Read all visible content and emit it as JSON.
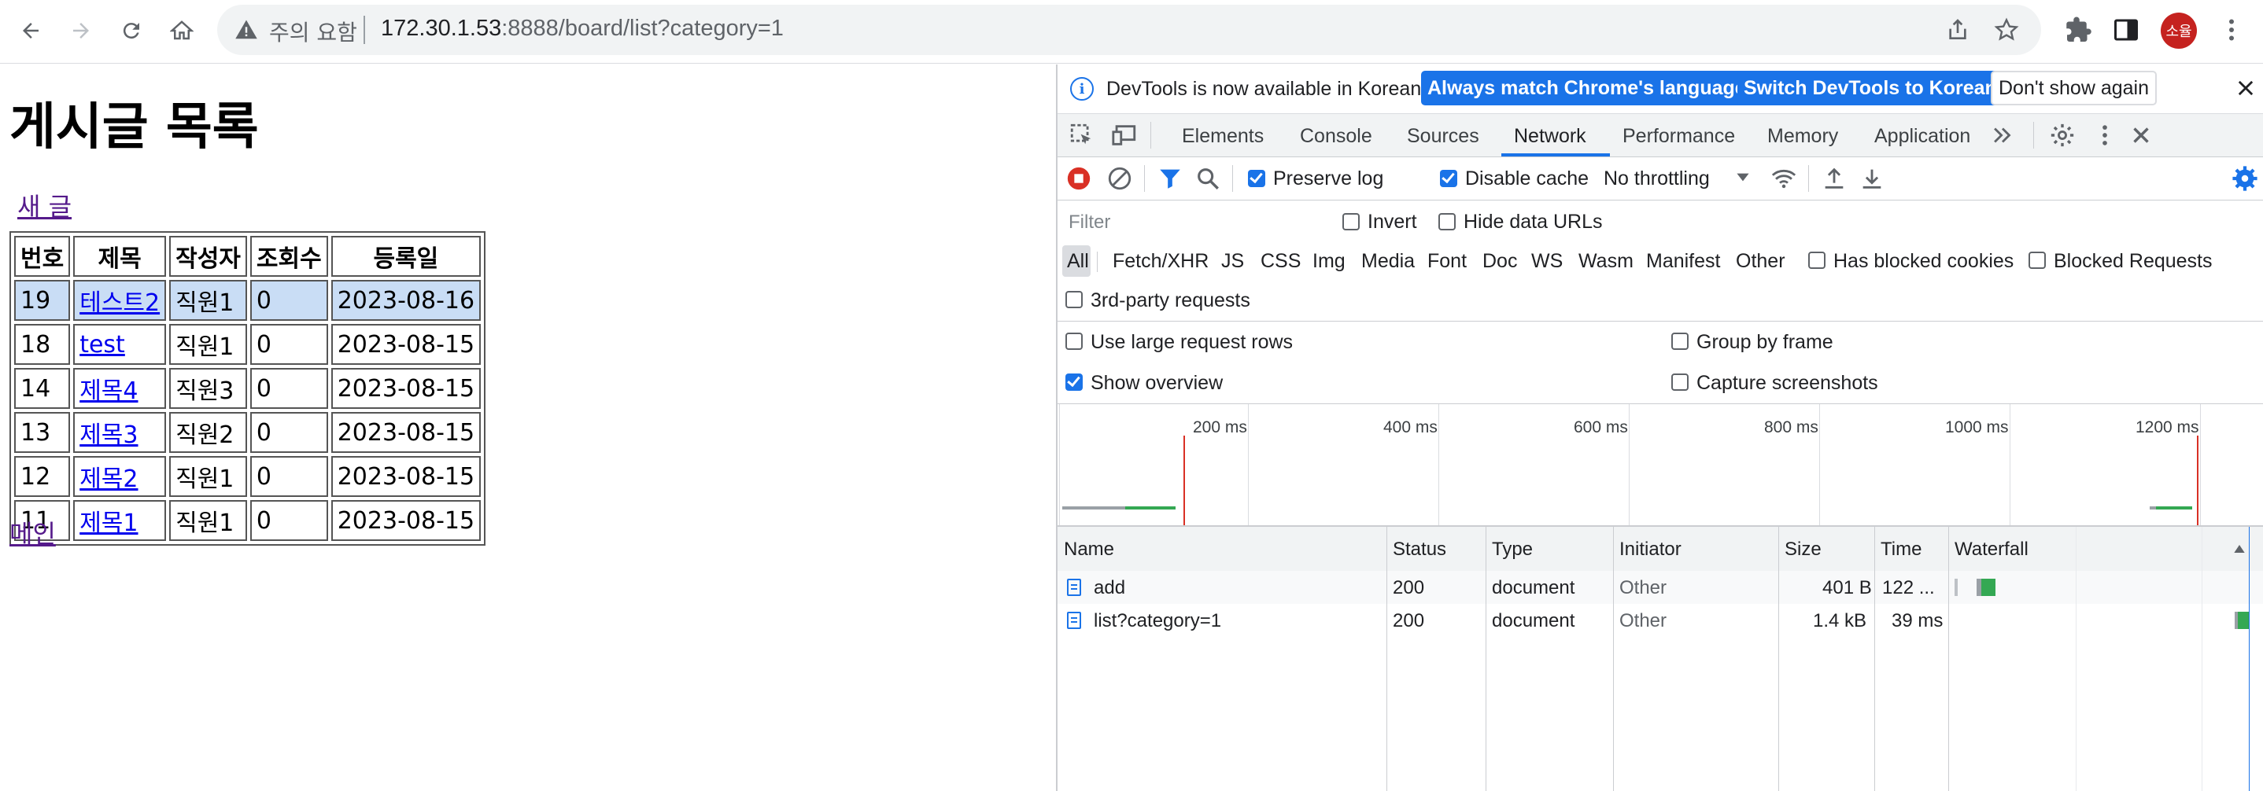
{
  "browser": {
    "warning_label": "주의 요함",
    "url_host": "172.30.1.53",
    "url_rest": ":8888/board/list?category=1",
    "avatar_label": "소율"
  },
  "page": {
    "title": "게시글 목록",
    "new_post_link": "새 글",
    "main_link": "메인",
    "table": {
      "headers": [
        "번호",
        "제목",
        "작성자",
        "조회수",
        "등록일"
      ],
      "rows": [
        {
          "no": "19",
          "title": "테스트2",
          "author": "직원1",
          "views": "0",
          "date": "2023-08-16"
        },
        {
          "no": "18",
          "title": "test",
          "author": "직원1",
          "views": "0",
          "date": "2023-08-15"
        },
        {
          "no": "14",
          "title": "제목4",
          "author": "직원3",
          "views": "0",
          "date": "2023-08-15"
        },
        {
          "no": "13",
          "title": "제목3",
          "author": "직원2",
          "views": "0",
          "date": "2023-08-15"
        },
        {
          "no": "12",
          "title": "제목2",
          "author": "직원1",
          "views": "0",
          "date": "2023-08-15"
        },
        {
          "no": "11",
          "title": "제목1",
          "author": "직원1",
          "views": "0",
          "date": "2023-08-15"
        }
      ]
    }
  },
  "devtools": {
    "infobar": {
      "message": "DevTools is now available in Korean!",
      "btn_match": "Always match Chrome's language",
      "btn_switch": "Switch DevTools to Korean",
      "btn_dismiss": "Don't show again"
    },
    "tabs": [
      "Elements",
      "Console",
      "Sources",
      "Network",
      "Performance",
      "Memory",
      "Application"
    ],
    "active_tab": "Network",
    "toolbar": {
      "preserve_log": "Preserve log",
      "disable_cache": "Disable cache",
      "throttling": "No throttling"
    },
    "filter": {
      "placeholder": "Filter",
      "invert": "Invert",
      "hide_data_urls": "Hide data URLs"
    },
    "types": [
      "All",
      "Fetch/XHR",
      "JS",
      "CSS",
      "Img",
      "Media",
      "Font",
      "Doc",
      "WS",
      "Wasm",
      "Manifest",
      "Other"
    ],
    "has_blocked_cookies": "Has blocked cookies",
    "blocked_requests": "Blocked Requests",
    "third_party": "3rd-party requests",
    "settings": {
      "large_rows": "Use large request rows",
      "group_by_frame": "Group by frame",
      "show_overview": "Show overview",
      "capture_screenshots": "Capture screenshots"
    },
    "overview_ticks": [
      "200 ms",
      "400 ms",
      "600 ms",
      "800 ms",
      "1000 ms",
      "1200 ms"
    ],
    "columns": [
      "Name",
      "Status",
      "Type",
      "Initiator",
      "Size",
      "Time",
      "Waterfall"
    ],
    "requests": [
      {
        "name": "add",
        "status": "200",
        "type": "document",
        "initiator": "Other",
        "size": "401 B",
        "time": "122 ..."
      },
      {
        "name": "list?category=1",
        "status": "200",
        "type": "document",
        "initiator": "Other",
        "size": "1.4 kB",
        "time": "39 ms"
      }
    ],
    "colors": {
      "accent": "#1a73e8",
      "record": "#d93025",
      "load_line": "#d93025",
      "waterfall_green": "#34a853"
    }
  }
}
